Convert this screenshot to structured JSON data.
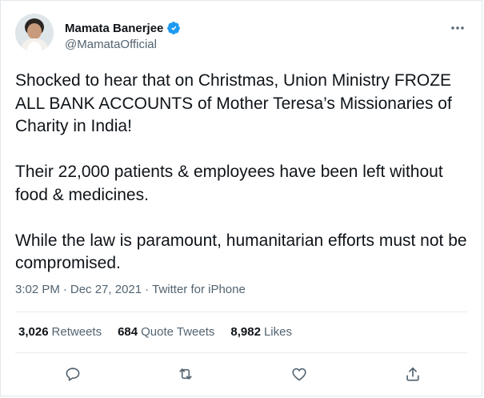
{
  "author": {
    "display_name": "Mamata Banerjee",
    "handle": "@MamataOfficial",
    "verified": true,
    "accent_color": "#1d9bf0"
  },
  "tweet": {
    "text": "Shocked to hear that on Christmas, Union Ministry FROZE ALL BANK ACCOUNTS of Mother Teresa’s Missionaries of Charity in India!\n\nTheir 22,000 patients & employees have been left without food & medicines.\n\nWhile the law is paramount, humanitarian efforts must not be compromised.",
    "time": "3:02 PM",
    "separator": "·",
    "date": "Dec 27, 2021",
    "source": "Twitter for iPhone"
  },
  "stats": {
    "retweets_count": "3,026",
    "retweets_label": "Retweets",
    "quotes_count": "684",
    "quotes_label": "Quote Tweets",
    "likes_count": "8,982",
    "likes_label": "Likes"
  },
  "icons": {
    "more": "more-icon",
    "reply": "reply-icon",
    "retweet": "retweet-icon",
    "like": "like-icon",
    "share": "share-icon",
    "verified": "verified-badge-icon"
  },
  "colors": {
    "text": "#0f1419",
    "secondary": "#536471",
    "divider": "#e6ecf0"
  }
}
